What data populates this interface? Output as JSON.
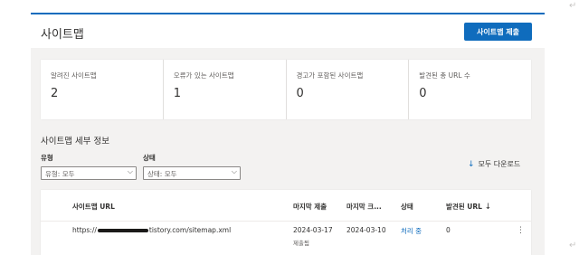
{
  "header": {
    "title": "사이트맵",
    "submit_button": "사이트맵 제출"
  },
  "stats": [
    {
      "label": "알려진 사이트맵",
      "value": "2"
    },
    {
      "label": "오류가 있는 사이트맵",
      "value": "1"
    },
    {
      "label": "경고가 포함된 사이트맵",
      "value": "0"
    },
    {
      "label": "발견된 총 URL 수",
      "value": "0"
    }
  ],
  "details": {
    "title": "사이트맵 세부 정보",
    "filters": {
      "type_label": "유형",
      "type_value": "유형: 모두",
      "status_label": "상태",
      "status_value": "상태: 모두"
    },
    "download_all": "모두 다운로드"
  },
  "table": {
    "columns": [
      "사이트맵 URL",
      "마지막 제출",
      "마지막 크...",
      "상태",
      "발견된 URL"
    ],
    "rows": [
      {
        "url_prefix": "https://",
        "url_suffix": "tistory.com/sitemap.xml",
        "last_submitted": "2024-03-17",
        "submitted_note": "제출됨",
        "last_crawled": "2024-03-10",
        "status": "처리 중",
        "discovered_urls": "0"
      }
    ]
  },
  "icons": {
    "chevron": "chevron-down-icon",
    "download": "download-icon",
    "sort": "sort-down-arrow-icon",
    "more": "more-vertical-icon"
  },
  "colors": {
    "accent": "#0f6cbd",
    "background": "#f3f2f1"
  }
}
